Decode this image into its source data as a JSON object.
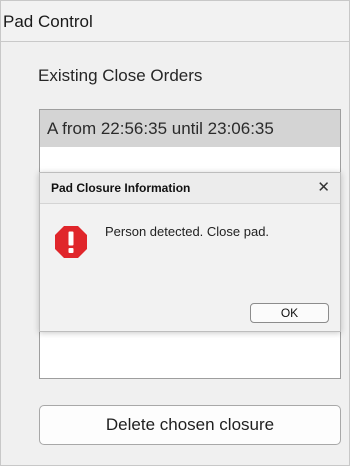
{
  "panel": {
    "title": "Pad Control",
    "heading": "Existing Close Orders",
    "close_orders": [
      "A from 22:56:35 until 23:06:35"
    ],
    "delete_button_label": "Delete chosen closure"
  },
  "dialog": {
    "title": "Pad Closure Information",
    "close_glyph": "✕",
    "icon": "error-icon",
    "icon_color": "#e0262b",
    "message": "Person detected. Close pad.",
    "ok_label": "OK"
  }
}
